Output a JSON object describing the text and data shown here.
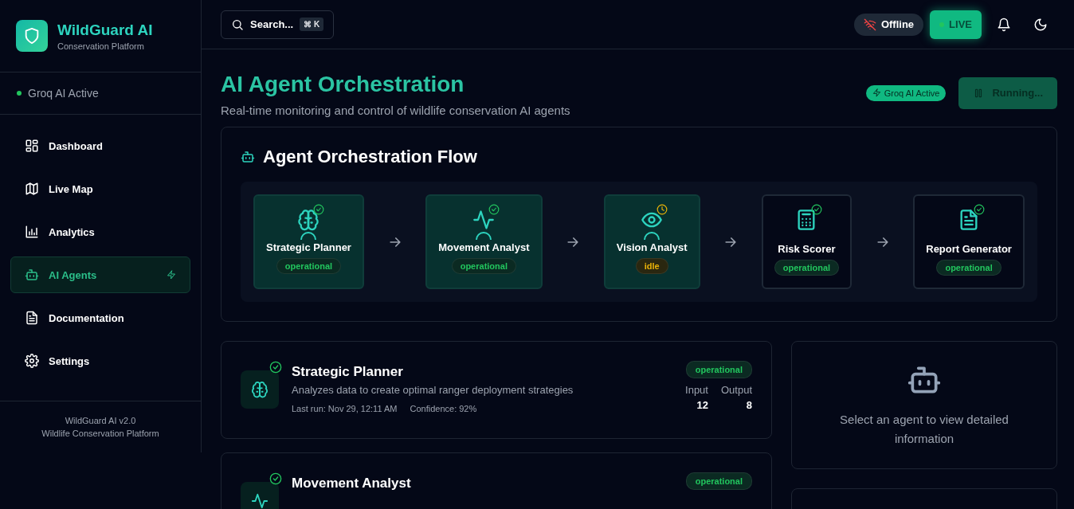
{
  "sidebar": {
    "brand": {
      "name": "WildGuard AI",
      "tagline": "Conservation Platform"
    },
    "ai_status": {
      "label": "Groq AI Active",
      "active": true
    },
    "items": [
      {
        "label": "Dashboard",
        "selected": false
      },
      {
        "label": "Live Map",
        "selected": false
      },
      {
        "label": "Analytics",
        "selected": false
      },
      {
        "label": "AI Agents",
        "selected": true
      },
      {
        "label": "Documentation",
        "selected": false
      },
      {
        "label": "Settings",
        "selected": false
      }
    ],
    "footer": [
      "WildGuard AI v2.0",
      "Wildlife Conservation Platform"
    ]
  },
  "topbar": {
    "search": {
      "label": "Search...",
      "shortcut": "⌘ K"
    },
    "connection": {
      "label": "Offline",
      "online": false
    },
    "live": {
      "label": "LIVE",
      "on": true
    }
  },
  "page": {
    "title": "AI Agent Orchestration",
    "subtitle": "Real-time monitoring and control of wildlife conservation AI agents",
    "ai_badge": "Groq AI Active",
    "run_button": {
      "label": "Running...",
      "running": true
    }
  },
  "flow": {
    "title": "Agent Orchestration Flow",
    "nodes": [
      {
        "name": "Strategic Planner",
        "status": "operational",
        "kind": "ok",
        "highlighted": true
      },
      {
        "name": "Movement Analyst",
        "status": "operational",
        "kind": "ok",
        "highlighted": true
      },
      {
        "name": "Vision Analyst",
        "status": "idle",
        "kind": "idle",
        "highlighted": true
      },
      {
        "name": "Risk Scorer",
        "status": "operational",
        "kind": "ok",
        "highlighted": false
      },
      {
        "name": "Report Generator",
        "status": "operational",
        "kind": "ok",
        "highlighted": false
      }
    ]
  },
  "agents": [
    {
      "name": "Strategic Planner",
      "status": "operational",
      "kind": "ok",
      "description": "Analyzes data to create optimal ranger deployment strategies",
      "last_run": "Last run: Nov 29, 12:11 AM",
      "confidence": "Confidence: 92%",
      "input_label": "Input",
      "input": "12",
      "output_label": "Output",
      "output": "8"
    },
    {
      "name": "Movement Analyst",
      "status": "operational",
      "kind": "ok"
    }
  ],
  "detail": {
    "message": "Select an agent to view detailed information"
  }
}
